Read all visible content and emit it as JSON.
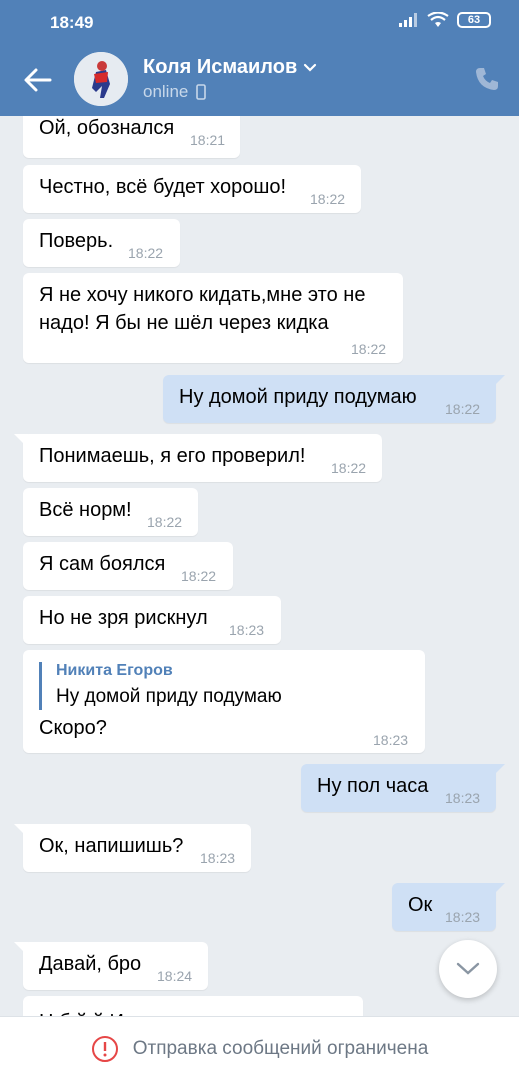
{
  "status_bar": {
    "time": "18:49",
    "battery": "63"
  },
  "header": {
    "contact_name": "Коля Исмаилов",
    "status": "online"
  },
  "messages": [
    {
      "text": "Ой, обознался",
      "time": "18:21"
    },
    {
      "text": "Честно, всё будет хорошо!",
      "time": "18:22"
    },
    {
      "text": "Поверь.",
      "time": "18:22"
    },
    {
      "text": "Я не хочу никого кидать,мне это не надо! Я бы не шёл через кидка",
      "time": "18:22"
    },
    {
      "text": "Ну домой приду подумаю",
      "time": "18:22"
    },
    {
      "text": "Понимаешь, я его проверил!",
      "time": "18:22"
    },
    {
      "text": "Всё норм!",
      "time": "18:22"
    },
    {
      "text": "Я сам боялся",
      "time": "18:22"
    },
    {
      "text": "Но не зря рискнул",
      "time": "18:23"
    },
    {
      "reply_name": "Никита Егоров",
      "reply_text": "Ну домой приду подумаю",
      "text": "Скоро?",
      "time": "18:23"
    },
    {
      "text": "Ну пол часа",
      "time": "18:23"
    },
    {
      "text": "Ок, напишишь?",
      "time": "18:23"
    },
    {
      "text": "Ок",
      "time": "18:23"
    },
    {
      "text": "Давай, бро",
      "time": "18:24"
    },
    {
      "text": "Н б й     й И",
      "time": ""
    }
  ],
  "footer": {
    "notice": "Отправка сообщений ограничена"
  },
  "colors": {
    "header": "#5181b8",
    "outgoing_bubble": "#cfe0f5",
    "incoming_bubble": "#ffffff",
    "background": "#e9edf1",
    "warning": "#e64646"
  },
  "icons": [
    "back-arrow-icon",
    "chevron-down-icon",
    "mobile-icon",
    "phone-icon",
    "signal-icon",
    "wifi-icon",
    "battery-icon",
    "scroll-down-icon",
    "warning-icon"
  ]
}
